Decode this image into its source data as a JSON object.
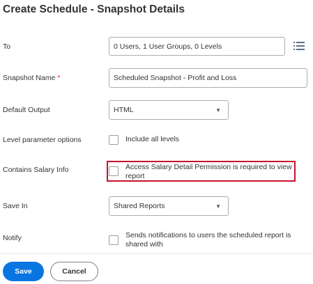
{
  "page": {
    "title": "Create Schedule - Snapshot Details"
  },
  "form": {
    "to": {
      "label": "To",
      "value": "0 Users, 1 User Groups, 0 Levels",
      "icon": "list-icon"
    },
    "snapshot_name": {
      "label": "Snapshot Name",
      "required_mark": "*",
      "value": "Scheduled Snapshot - Profit and Loss"
    },
    "default_output": {
      "label": "Default Output",
      "value": "HTML"
    },
    "level_parameter": {
      "label": "Level parameter options",
      "checkbox_label": "Include all levels"
    },
    "salary_info": {
      "label": "Contains Salary Info",
      "checkbox_label_line1": "Access Salary Detail Permission is required to view",
      "checkbox_label_line2": "report",
      "highlight_color": "#c8102e"
    },
    "save_in": {
      "label": "Save In",
      "value": "Shared Reports"
    },
    "notify": {
      "label": "Notify",
      "checkbox_label_line1": "Sends notifications to users the scheduled report is",
      "checkbox_label_line2": "shared with"
    }
  },
  "buttons": {
    "save": "Save",
    "cancel": "Cancel",
    "save_color": "#0875e1"
  }
}
